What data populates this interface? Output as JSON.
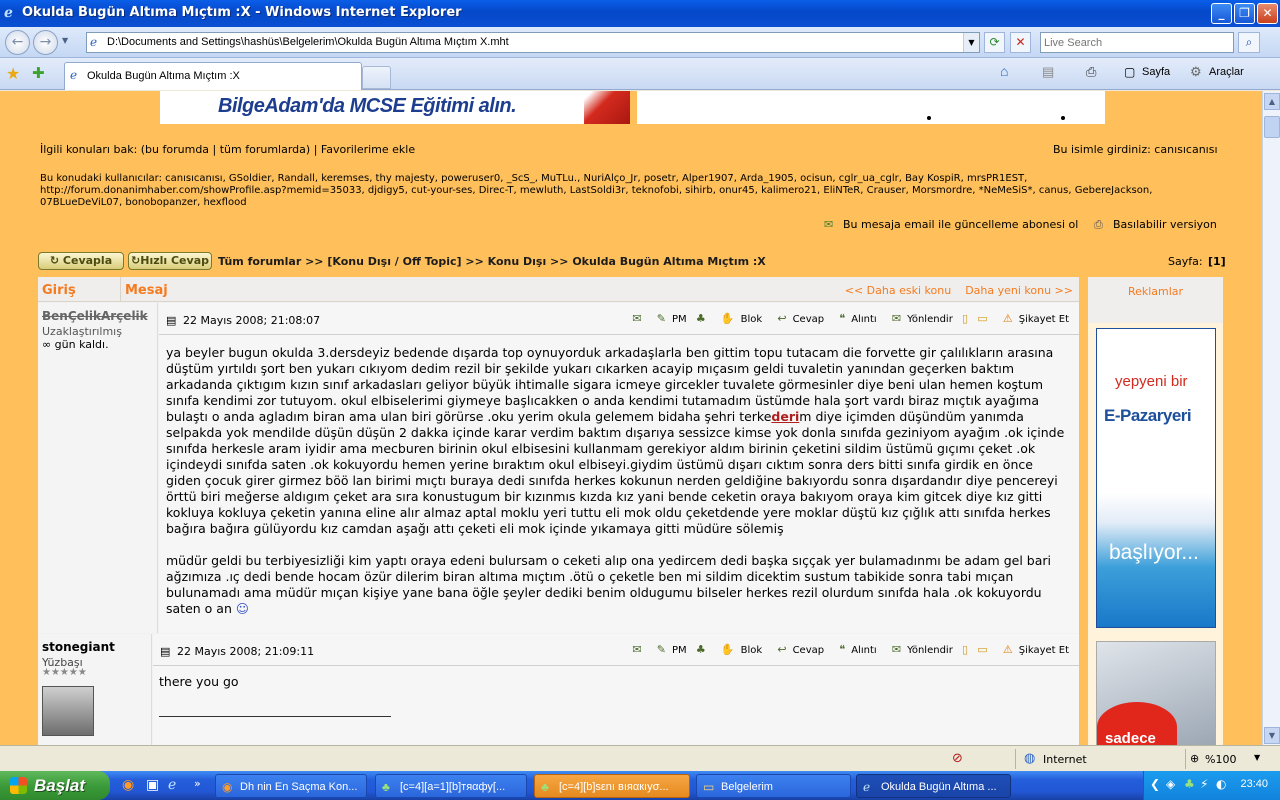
{
  "window": {
    "title": "Okulda Bugün Altıma Mıçtım :X - Windows Internet Explorer"
  },
  "address_bar": {
    "url": "D:\\Documents and Settings\\hashüs\\Belgelerim\\Okulda Bugün Altıma Mıçtım X.mht",
    "search_placeholder": "Live Search"
  },
  "tab": {
    "label": "Okulda Bugün Altıma Mıçtım :X"
  },
  "command_bar": {
    "page_label": "Sayfa",
    "tools_label": "Araçlar"
  },
  "page": {
    "banner_left_text": "BilgeAdam'da MCSE Eğitimi alın.",
    "related_label": "İlgili konuları bak: (bu forumda | tüm forumlarda) | Favorilerime ekle",
    "logged_in_label": "Bu isimle girdiniz: canısıcanısı",
    "users_label": "Bu konudaki kullanıcılar: canısıcanısı, GSoldier, Randall, keremses, thy majesty, poweruser0, _ScS_, MuTLu., NuriAlço_Jr, posetr, Alper1907, Arda_1905, ocisun, cglr_ua_cglr, Bay KospiR, mrsPR1EST, http://forum.donanimhaber.com/showProfile.asp?memid=35033, djdigy5, cut-your-ses, Direc-T, mewluth, LastSoldi3r, teknofobi, sihirb, onur45, kalimero21, EliNTeR, Crauser, Morsmordre, *NeMeSiS*, canus, GebereJackson, 07BLueDeViL07, bonobopanzer, hexflood",
    "subscribe_label": "Bu mesaja email ile güncelleme abonesi ol",
    "print_label": "Basılabilir versiyon",
    "reply_button": "Cevapla",
    "quick_reply_button": "Hızlı Cevap",
    "breadcrumb": "Tüm forumlar >> [Konu Dışı / Off Topic] >> Konu Dışı >> Okulda Bugün Altıma Mıçtım :X",
    "page_label": "Sayfa:",
    "page_number": "[1]"
  },
  "forum_table": {
    "col_login": "Giriş",
    "col_message": "Mesaj",
    "prev_topic": "<< Daha eski konu",
    "next_topic": "Daha yeni konu >>",
    "ads_label": "Reklamlar"
  },
  "post_tools": {
    "pm": "PM",
    "block": "Blok",
    "reply": "Cevap",
    "quote": "Alıntı",
    "forward": "Yönlendir",
    "report": "Şikayet Et"
  },
  "posts": [
    {
      "author": "BenÇelikArçelik",
      "rank": "Uzaklaştırılmış",
      "extra": "∞ gün kaldı.",
      "date": "22 Mayıs 2008; 21:08:07",
      "body_p1_a": "ya beyler bugun okulda 3.dersdeyiz bedende dışarda top oynuyorduk arkadaşlarla ben gittim topu tutacam die forvette gir çalılıkların arasına düştüm yırtıldı şort ben yukarı cıkıyom dedim rezil bir şekilde yukarı cıkarken acayip mıçasım geldi tuvaletin yanından geçerken baktım arkadanda çıktıgım kızın sınıf arkadasları geliyor büyük ihtimalle sigara icmeye gircekler tuvalete görmesinler diye beni ulan hemen koştum sınıfa kendimi zor tutuyom. okul elbiselerimi giymeye başlıcakken o anda kendimi tutamadım üstümde hala şort vardı biraz mıçtık ayağıma bulaştı o anda agladım biran ama ulan biri görürse .oku yerim okula gelemem bidaha şehri terke",
      "body_link": "deri",
      "body_p1_b": "m diye içimden düşündüm yanımda selpakda yok mendilde düşün düşün 2 dakka içinde karar verdim baktım dışarıya sessizce kimse yok donla sınıfda geziniyom ayağım .ok içinde sınıfda herkesle aram iyidir ama mecburen birinin okul elbisesini kullanmam gerekiyor aldım birinin çeketini sildim üstümü gıçımı çeket .ok içindeydi sınıfda saten .ok kokuyordu hemen yerine bıraktım okul elbiseyi.giydim üstümü dışarı cıktım sonra ders bitti sınıfa girdik en önce giden çocuk girer girmez böö lan birimi mıçtı buraya dedi sınıfda herkes kokunun nerden geldiğine bakıyordu sonra dışardandır diye pencereyi örttü biri meğerse aldıgım çeket ara sıra konustugum bir kızınmıs kızda kız yani bende ceketin oraya bakıyom oraya kim gitcek diye kız gitti kokluya kokluya çeketin yanına eline alır almaz aptal moklu yeri tuttu eli mok oldu çeketdende yere moklar düştü kız çığlık attı sınıfda herkes bağıra bağıra gülüyordu kız camdan aşağı attı çeketi eli mok içinde yıkamaya gitti müdüre sölemiş",
      "body_p2": "müdür geldi bu terbiyesizliği kim yaptı oraya edeni bulursam o ceketi alıp ona yedircem dedi başka sıççak yer bulamadınmı be adam gel bari ağzımıza .ıç dedi bende hocam özür dilerim biran altıma mıçtım .ötü o çeketle ben mi sildim dicektim sustum tabikide sonra tabi mıçan bulunamadı ama müdür mıçan kişiye yane bana öğle şeyler dediki benim oldugumu bilseler herkes rezil olurdum sınıfda hala .ok kokuyordu saten o an"
    },
    {
      "author": "stonegiant",
      "rank": "Yüzbaşı",
      "stars": "★★★★★",
      "date": "22 Mayıs 2008; 21:09:11",
      "body": "there you go"
    }
  ],
  "ads": {
    "ad1_line1": "yepyeni bir",
    "ad1_line2": "E-Pazaryeri",
    "ad1_line3": "başlıyor...",
    "ad2_text": "sadece"
  },
  "status_bar": {
    "zone": "Internet",
    "zoom": "%100"
  },
  "taskbar": {
    "start_label": "Başlat",
    "tasks": [
      "Dh nin En Saçma Kon...",
      "[c=4][a=1][b]тяαфу[...",
      "[c=4][b]sεnı вıяαкıуσ...",
      "Belgelerim",
      "Okulda Bugün Altıma ..."
    ],
    "clock": "23:40"
  },
  "colors": {
    "page_bg": "#ffc05b",
    "accent_orange": "#f47b20",
    "xp_blue": "#245edb"
  }
}
